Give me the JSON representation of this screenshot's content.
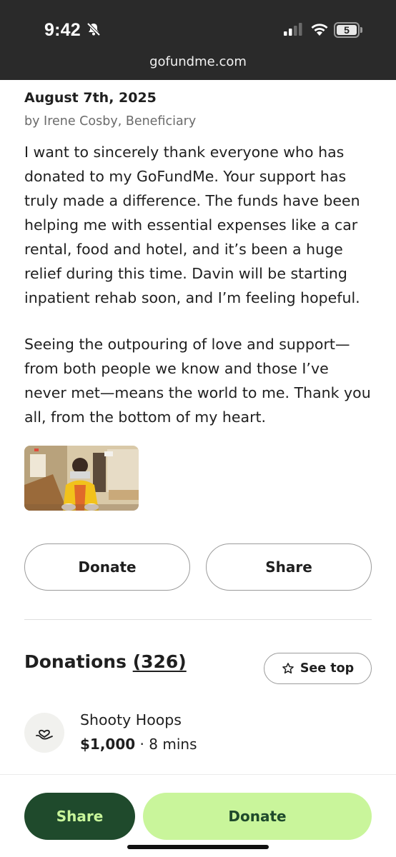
{
  "status_bar": {
    "time": "9:42",
    "battery": "5",
    "url": "gofundme.com"
  },
  "update": {
    "date": "August 7th, 2025",
    "byline": "by Irene Cosby, Beneficiary",
    "paragraph_1": "I want to sincerely thank everyone who has donated to my GoFundMe. Your support has truly made a difference. The funds have been helping me with essential expenses like a car rental, food and hotel, and it’s been a huge relief during this time. Davin will be starting inpatient rehab soon, and I’m feeling hopeful.",
    "paragraph_2": "Seeing the outpouring of love and support—from both people we know and those I’ve never met—means the world to me. Thank you all, from the bottom of my heart."
  },
  "actions": {
    "donate_label": "Donate",
    "share_label": "Share"
  },
  "donations": {
    "title": "Donations",
    "count": "(326)",
    "see_top_label": "See top",
    "items": [
      {
        "name": "Shooty Hoops",
        "amount": "$1,000",
        "separator": " · ",
        "time": "8 mins"
      }
    ]
  },
  "bottom_bar": {
    "share_label": "Share",
    "donate_label": "Donate"
  },
  "colors": {
    "status_bar_bg": "#2a2a2a",
    "brand_dark_green": "#1f4a2c",
    "brand_light_green": "#c9f59b"
  },
  "icons": [
    "bell-slash-icon",
    "cellular-signal-icon",
    "wifi-icon",
    "battery-icon",
    "star-icon",
    "heart-hand-icon"
  ]
}
